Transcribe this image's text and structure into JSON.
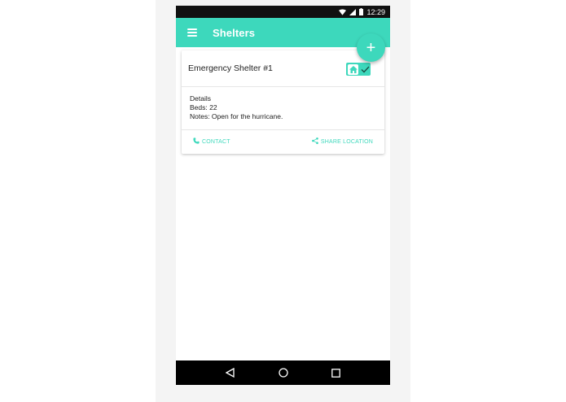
{
  "status_bar": {
    "time": "12:29"
  },
  "app_bar": {
    "title": "Shelters",
    "menu_icon": "menu-icon"
  },
  "fab": {
    "label": "+",
    "icon": "add-icon"
  },
  "shelter_card": {
    "title": "Emergency Shelter #1",
    "details_heading": "Details",
    "beds": "Beds: 22",
    "notes": "Notes: Open for the hurricane.",
    "contact_label": "CONTACT",
    "share_label": "SHARE LOCATION",
    "status_toggle": {
      "checked": true
    }
  },
  "nav_bar": {
    "buttons": [
      "back-icon",
      "home-icon",
      "recents-icon"
    ]
  },
  "colors": {
    "accent": "#3dd8bc",
    "accent_dark": "#2fbfa4",
    "status_bar": "#111111",
    "nav_bar": "#000000"
  }
}
